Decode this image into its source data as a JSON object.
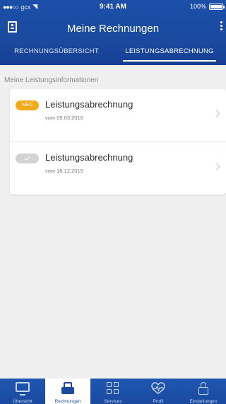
{
  "status_bar": {
    "signal": "●●●○○",
    "carrier": "gcx",
    "time": "9:41 AM",
    "battery": "100%"
  },
  "header": {
    "title": "Meine Rechnungen",
    "tabs": [
      {
        "label": "RECHNUNGSÜBERSICHT",
        "active": false
      },
      {
        "label": "LEISTUNGSABRECHNUNG",
        "active": true
      }
    ]
  },
  "section": {
    "title": "Meine Leistungsinformationen"
  },
  "items": [
    {
      "badge": "NEU",
      "title": "Leistungsabrechnung",
      "date": "vom 09.03.2016",
      "status": "new"
    },
    {
      "badge": "",
      "title": "Leistungsabrechnung",
      "date": "vom 18.12.2015",
      "status": "read"
    }
  ],
  "tabbar": [
    {
      "label": "Übersicht",
      "icon": "monitor-icon",
      "active": false
    },
    {
      "label": "Rechnungen",
      "icon": "tray-icon",
      "active": true
    },
    {
      "label": "Services",
      "icon": "grid-icon",
      "active": false
    },
    {
      "label": "Profil",
      "icon": "heart-icon",
      "active": false
    },
    {
      "label": "Einstellungen",
      "icon": "lock-icon",
      "active": false
    }
  ],
  "colors": {
    "brand_blue": "#1a4aa0",
    "badge_new": "#f2a91a",
    "badge_read": "#d3d3d3",
    "background": "#efefef"
  }
}
